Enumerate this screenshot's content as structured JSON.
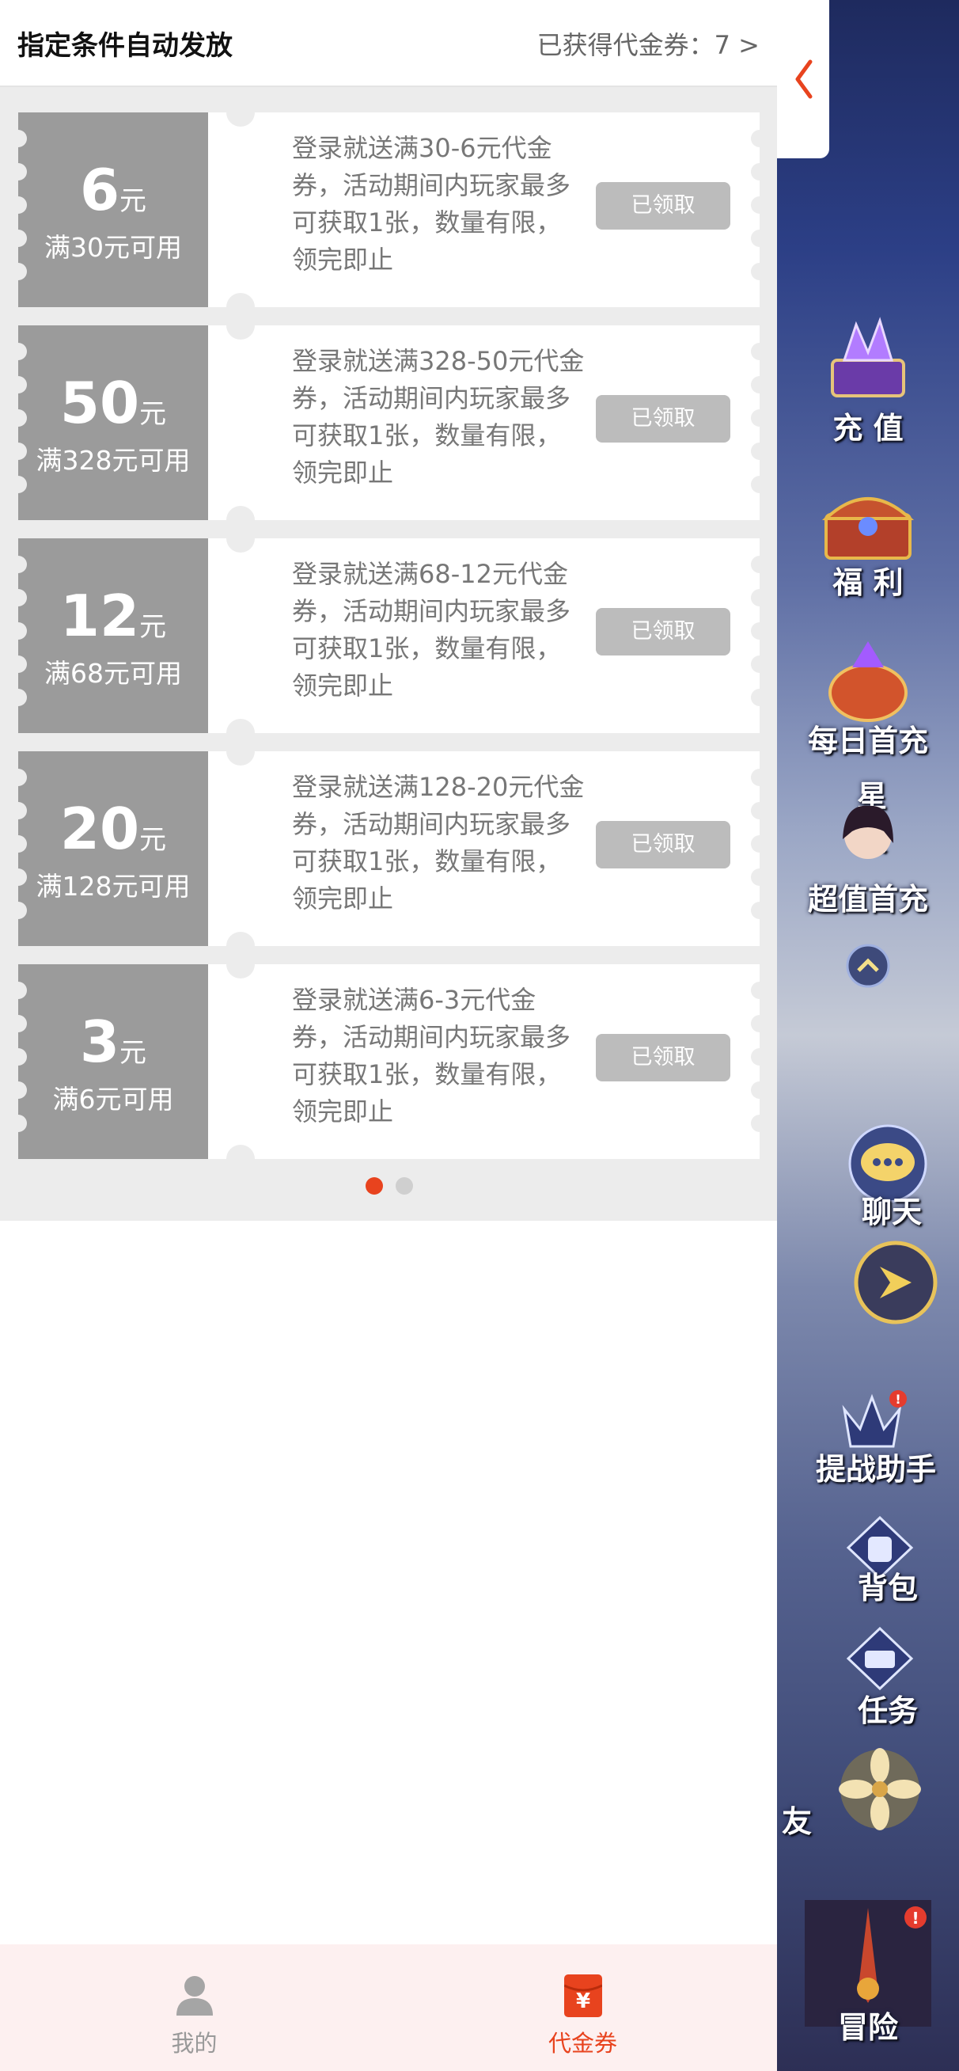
{
  "header": {
    "title": "指定条件自动发放",
    "obtained": "已获得代金券：7 >"
  },
  "coupons": [
    {
      "amount": "6",
      "unit": "元",
      "condition": "满30元可用",
      "description": "登录就送满30-6元代金券，活动期间内玩家最多可获取1张，数量有限，领完即止",
      "button": "已领取"
    },
    {
      "amount": "50",
      "unit": "元",
      "condition": "满328元可用",
      "description": "登录就送满328-50元代金券，活动期间内玩家最多可获取1张，数量有限，领完即止",
      "button": "已领取"
    },
    {
      "amount": "12",
      "unit": "元",
      "condition": "满68元可用",
      "description": "登录就送满68-12元代金券，活动期间内玩家最多可获取1张，数量有限，领完即止",
      "button": "已领取"
    },
    {
      "amount": "20",
      "unit": "元",
      "condition": "满128元可用",
      "description": "登录就送满128-20元代金券，活动期间内玩家最多可获取1张，数量有限，领完即止",
      "button": "已领取"
    },
    {
      "amount": "3",
      "unit": "元",
      "condition": "满6元可用",
      "description": "登录就送满6-3元代金券，活动期间内玩家最多可获取1张，数量有限，领完即止",
      "button": "已领取"
    }
  ],
  "pagination": {
    "current": 1,
    "total": 2
  },
  "bottom_nav": {
    "mine_label": "我的",
    "coupon_label": "代金券",
    "coupon_icon_glyph": "¥",
    "active_color": "#e8431e",
    "inactive_color": "#999999"
  },
  "game_sidebar": {
    "items": [
      {
        "label": "充 值",
        "icon": "crystal-chest-icon"
      },
      {
        "label": "福 利",
        "icon": "treasure-chest-icon"
      },
      {
        "label": "每日首充",
        "icon": "gift-pouch-icon"
      },
      {
        "label": "超值首充",
        "icon": "character-portrait-icon"
      },
      {
        "label": "聊天",
        "icon": "chat-bubble-icon"
      },
      {
        "label": "提战助手",
        "icon": "crown-v-icon"
      },
      {
        "label": "背包",
        "icon": "backpack-icon"
      },
      {
        "label": "任务",
        "icon": "scroll-icon"
      },
      {
        "label": "冒险",
        "icon": "sword-icon"
      }
    ],
    "partial_labels": {
      "star": "星",
      "chen": "辰",
      "you": "友"
    },
    "badge": "!"
  }
}
